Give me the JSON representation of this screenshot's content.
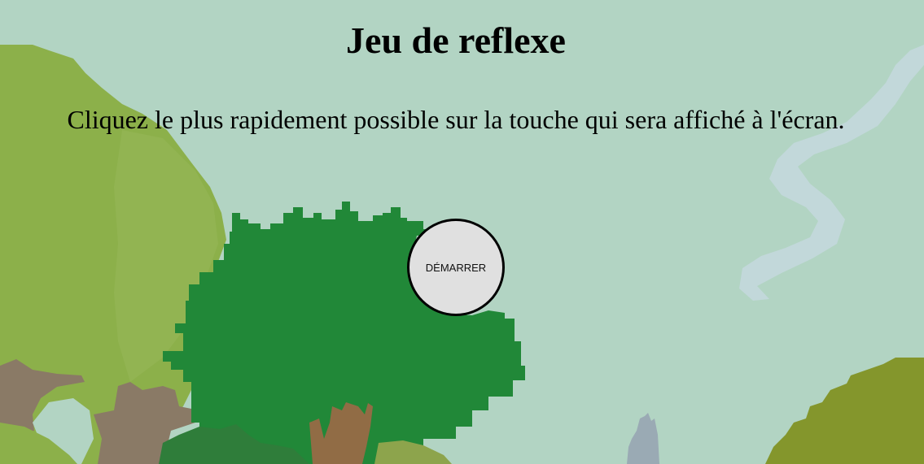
{
  "title": "Jeu de reflexe",
  "instructions": "Cliquez le plus rapidement possible sur la touche qui sera affiché à l'écran.",
  "start_button": {
    "label": "DÉMARRER"
  },
  "colors": {
    "sky": "#b2d4c3",
    "foreground_tree": "#218838",
    "background_tree": "#8cb04a",
    "right_hill": "#84962c",
    "mist": "#c2d8da",
    "trunk": "#8a7a66",
    "button_fill": "#e0e0e0",
    "button_border": "#000000"
  }
}
